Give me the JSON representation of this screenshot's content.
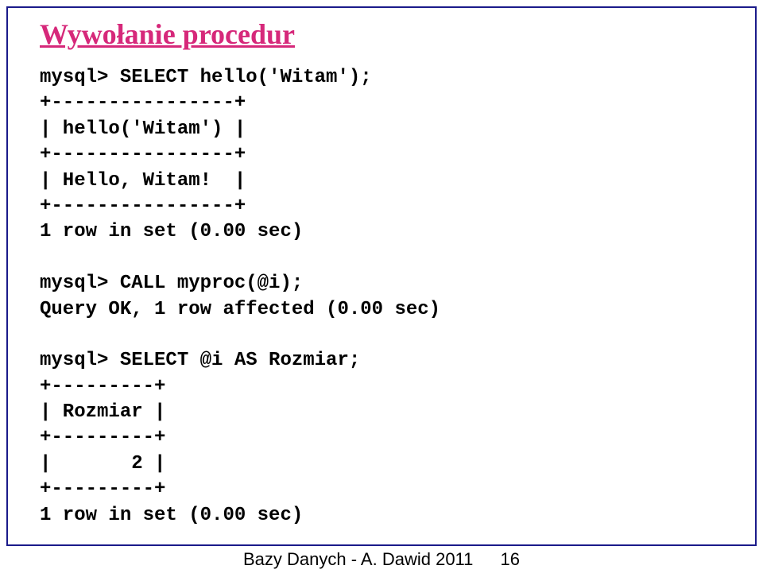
{
  "title": "Wywołanie procedur",
  "code": "mysql> SELECT hello('Witam');\n+----------------+\n| hello('Witam') |\n+----------------+\n| Hello, Witam!  |\n+----------------+\n1 row in set (0.00 sec)\n\nmysql> CALL myproc(@i);\nQuery OK, 1 row affected (0.00 sec)\n\nmysql> SELECT @i AS Rozmiar;\n+---------+\n| Rozmiar |\n+---------+\n|       2 |\n+---------+\n1 row in set (0.00 sec)",
  "footer": {
    "text": "Bazy Danych - A. Dawid 2011",
    "page": "16"
  }
}
